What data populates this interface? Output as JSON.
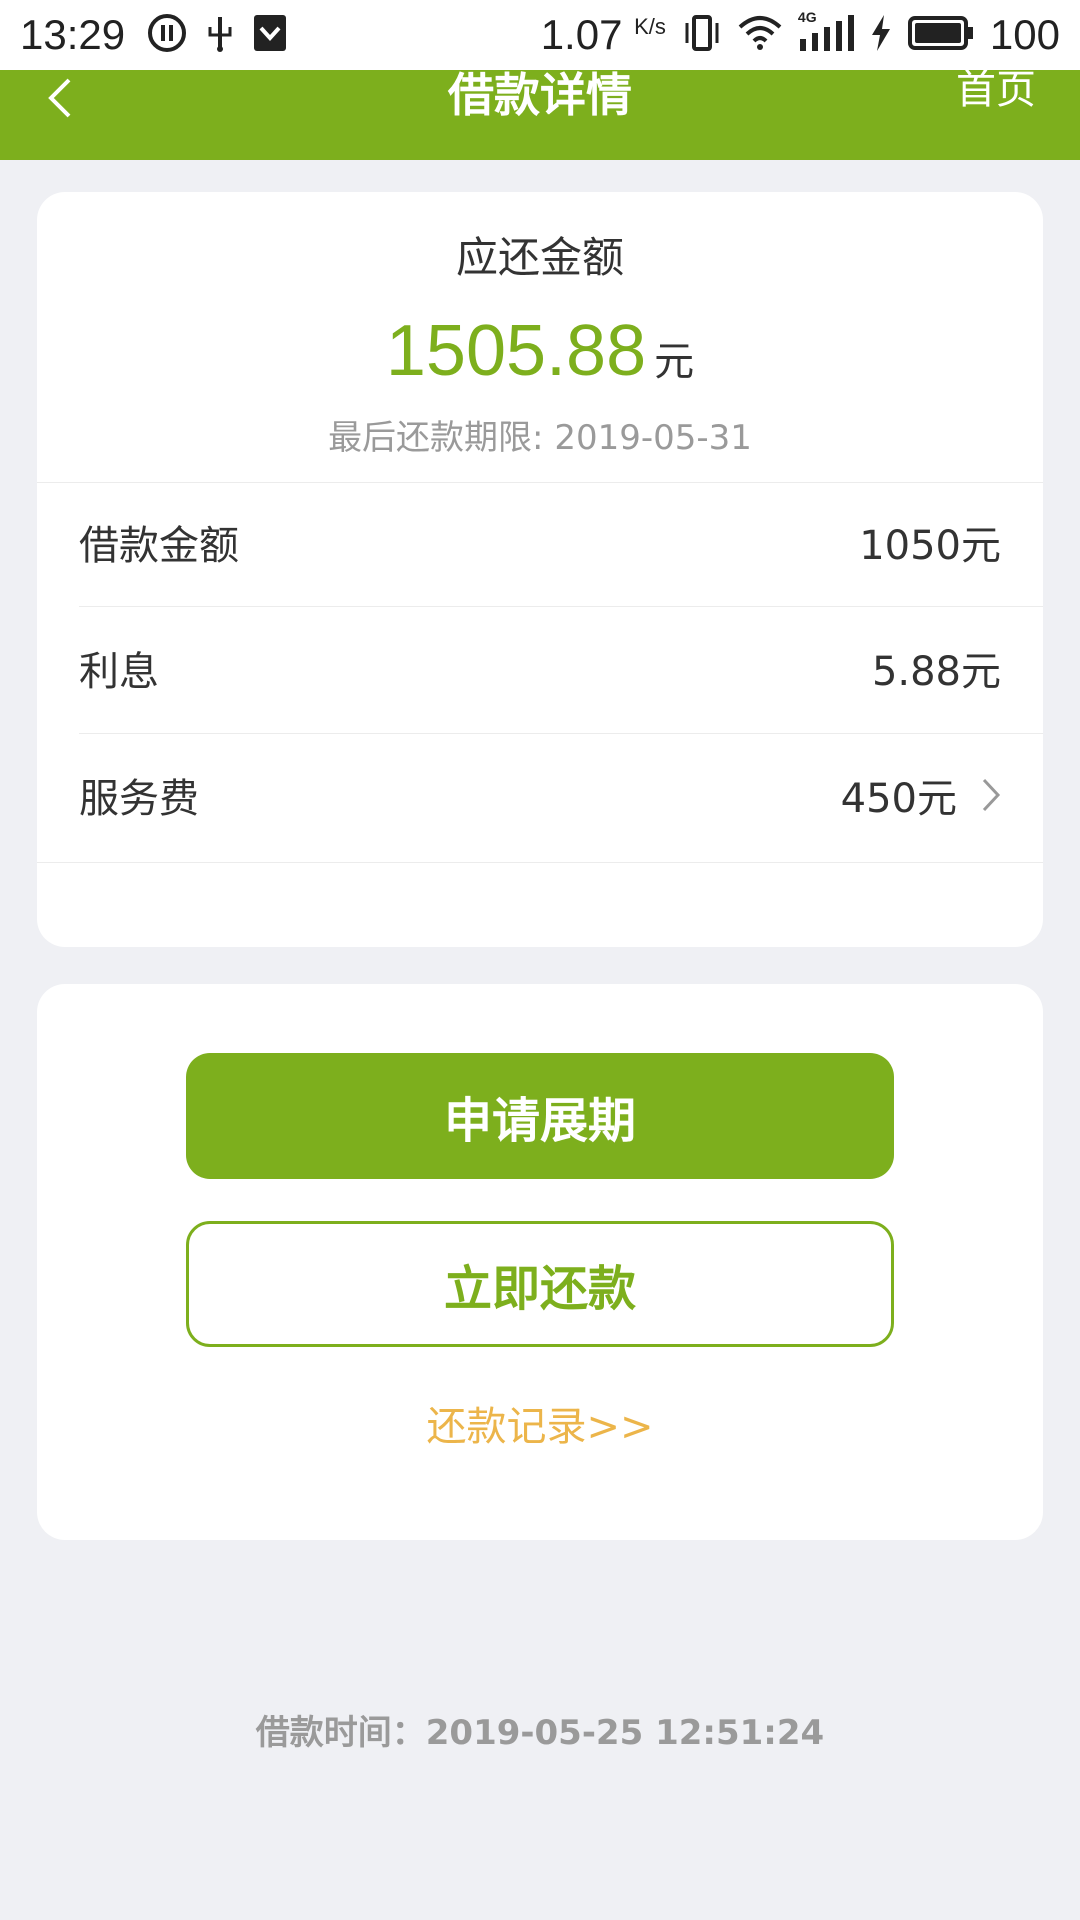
{
  "status_bar": {
    "time": "13:29",
    "net_speed": "1.07",
    "net_unit": "K/s",
    "network_type": "4G",
    "battery": "100",
    "icons": [
      "pause-circle-icon",
      "usb-icon",
      "shield-icon",
      "vibrate-icon",
      "wifi-icon",
      "signal-icon",
      "charging-icon",
      "battery-icon"
    ]
  },
  "app_bar": {
    "title": "借款详情",
    "home_label": "首页"
  },
  "summary": {
    "due_label": "应还金额",
    "due_amount": "1505.88",
    "due_unit": "元",
    "deadline": "最后还款期限: 2019-05-31"
  },
  "details": [
    {
      "label": "借款金额",
      "value": "1050元"
    },
    {
      "label": "利息",
      "value": "5.88元"
    },
    {
      "label": "服务费",
      "value": "450元"
    }
  ],
  "actions": {
    "extend_label": "申请展期",
    "repay_label": "立即还款",
    "records_label": "还款记录>>"
  },
  "loan_time": "借款时间：2019-05-25 12:51:24",
  "colors": {
    "brand_green": "#7daf1d",
    "link_orange": "#ecb54a",
    "background": "#eff0f4"
  }
}
